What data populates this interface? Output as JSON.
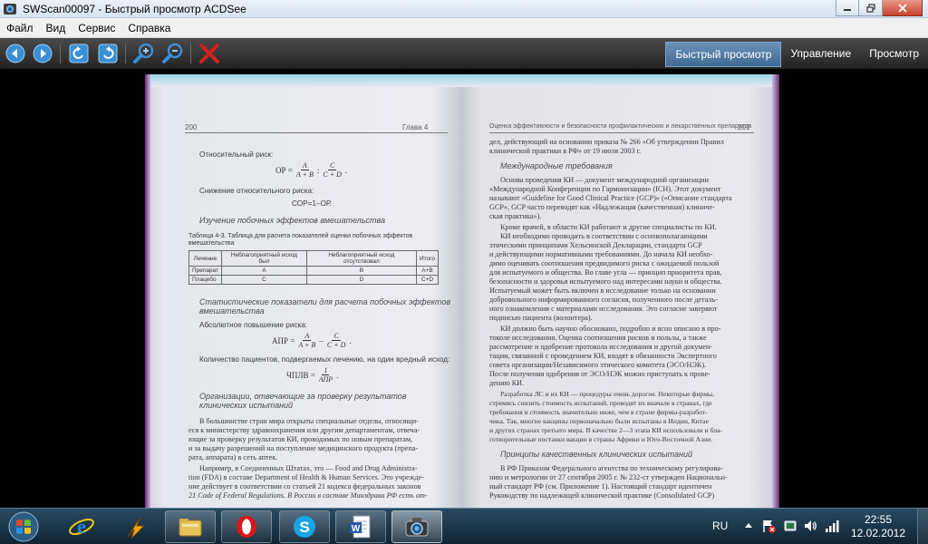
{
  "window": {
    "title": "SWScan00097 - Быстрый просмотр ACDSee"
  },
  "menu": [
    "Файл",
    "Вид",
    "Сервис",
    "Справка"
  ],
  "toolbar": {
    "modes": [
      {
        "label": "Быстрый просмотр",
        "active": true
      },
      {
        "label": "Управление",
        "active": false
      },
      {
        "label": "Просмотр",
        "active": false
      }
    ]
  },
  "document": {
    "left_page": {
      "page_number": "200",
      "chapter": "Глава 4",
      "relative_risk_label": "Относительный риск:",
      "f1_lhs": "ОР =",
      "f1_a": "A",
      "f1_ab": "A + B",
      "f1_c": "C",
      "f1_cd": "C + D",
      "rr_reduction_label": "Снижение относительного риска:",
      "f2": "СОР=1–ОР.",
      "sub1": "Изучение побочных эффектов вмешательства",
      "table_caption_1": "Таблица 4-3. Таблица для расчета показателей оценки побочных эффектов",
      "table_caption_2": "вмешательства",
      "table": {
        "headers": [
          "Лечение",
          "Неблагоприятный исход был",
          "Неблагоприятный исход отсутствовал",
          "Итого"
        ],
        "rows": [
          [
            "Препарат",
            "A",
            "B",
            "A+B"
          ],
          [
            "Плацебо",
            "C",
            "D",
            "C+D"
          ]
        ]
      },
      "sub2_1": "Статистические показатели для расчета побочных эффектов",
      "sub2_2": "вмешательства",
      "abs_increase_label": "Абсолютное повышение риска:",
      "f3_lhs": "АПР =",
      "f3_a": "A",
      "f3_ab": "A + B",
      "f3_c": "C",
      "f3_cd": "C + D",
      "nnh_label": "Количество пациентов, подвергаемых лечению, на один вредный исход:",
      "f4_lhs": "ЧПЛВ =",
      "f4_num": "1",
      "f4_den": "АПР",
      "sub3_1": "Организации, отвечающие за проверку результатов",
      "sub3_2": "клинических испытаний",
      "p1": [
        "В большинстве стран мира открыты специальные отделы, относящи-",
        "еся к министерству здравоохранения или другим департаментам, отвеча-",
        "ющие за проверку результатов КИ, проводимых по новым препаратам,",
        "и за выдачу разрешений на поступление медицинского продукта (препа-",
        "рата, аппарата) в сеть аптек."
      ],
      "p2": [
        "Например, в Соединенных Штатах, это — Food and Drug Administra-",
        "tion (FDA) в составе Department of Health & Human Services. Это учрежде-",
        "ние действует в соответствии со статьей 21 кодекса федеральных законов",
        "21 Code of Federal Regulations. В России в составе Минздрава РФ есть от-"
      ]
    },
    "right_page": {
      "header": "Оценка эффективности и безопасности профилактических и лекарственных препаратов",
      "page_number": "201",
      "intro": [
        "дел, действующий на основании приказа № 266 «Об утверждении Правил",
        "клинической практики в РФ» от 19 июля 2003 г."
      ],
      "sub1": "Международные требования",
      "p1": [
        "Основа проведения КИ — документ международной организации",
        "«Международной Конференции по Гармонизации» (ICH). Этот документ",
        "называют «Guideline for Good Clinical Practice (GCP)» («Описание стандарта",
        "GCP», GCP часто переводят как «Надлежащая (качественная) клиниче-",
        "ская практика»)."
      ],
      "p2": [
        "Кроме врачей, в области КИ работают и другие специалисты по КИ.",
        "КИ необходимо проводить в соответствии с основополагающими",
        "этическими принципами Хельсинской Декларации, стандарта GCP",
        "и действующими нормативными требованиями. До начала КИ необхо-",
        "димо оценивать соотношения предвидимого риска с ожидаемой пользой",
        "для испытуемого и общества. Во главе угла — принцип приоритета прав,",
        "безопасности и здоровья испытуемого над интересами науки и общества.",
        "Испытуемый может быть включен в исследование только на основании",
        "добровольного информированного согласия, полученного после деталь-",
        "ного ознакомления с материалами исследования. Это согласие заверяют",
        "подписью пациента (волонтера).",
        "КИ должно быть научно обосновано, подробно и ясно описано в про-",
        "токоле исследования. Оценка соотношения рисков и пользы, а также",
        "рассмотрение и одобрение протокола исследования и другой докумен-",
        "тации, связанной с проведением КИ, входят в обязанности Экспертного",
        "совета организации/Независимого этического комитета (ЭСО/НЭК).",
        "После получения одобрения от ЭСО/НЭК можно приступать к прове-",
        "дению КИ.",
        "Разработка ЛС и их КИ — процедуры очень дорогие. Некоторые фирмы,",
        "стремясь снизить стоимость испытаний, проводят их вначале в странах, где",
        "требования и стоимость значительно ниже, чем в стране фирмы-разработ-",
        "чика. Так, многие вакцины первоначально были испытаны в Индии, Китае",
        "и других странах третьего мира. В качестве 2—3 этапа КИ использовали и бла-",
        "готворительные поставки вакцин в страны Африки и Юго-Восточной Азии."
      ],
      "sub2": "Принципы качественных клинических испытаний",
      "p3": [
        "В РФ Приказом Федерального агентства по техническому регулирова-",
        "нию и метрологии от 27 сентября 2005 г. № 232-ст утвержден Национальн-",
        "ный стандарт РФ (см. Приложение 1). Настоящий стандарт идентичен",
        "Руководству по надлежащей клинической практике (Consolidated GCP)"
      ]
    }
  },
  "taskbar": {
    "language": "RU",
    "time": "22:55",
    "date": "12.02.2012"
  },
  "icons": {
    "back": "back-arrow-icon",
    "forward": "forward-arrow-icon",
    "rotate_left": "rotate-left-icon",
    "rotate_right": "rotate-right-icon",
    "zoom_in": "zoom-in-icon",
    "zoom_out": "zoom-out-icon",
    "delete": "delete-x-icon"
  },
  "colors": {
    "toolbar_icon_blue": "#3a8fd6",
    "delete_red": "#d42020",
    "active_tab": "#4a78a4"
  }
}
